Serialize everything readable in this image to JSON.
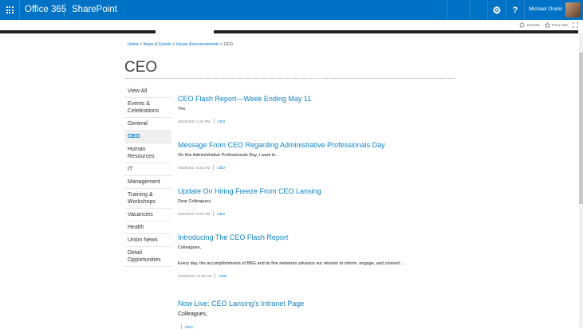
{
  "suite": {
    "brand": "Office 365",
    "app_name": "SharePoint",
    "settings_glyph": "⚙",
    "help_glyph": "?",
    "user_name": "Michael Osicki"
  },
  "actions": {
    "share": "SHARE",
    "follow": "FOLLOW"
  },
  "breadcrumb": {
    "items": [
      "Home",
      "News & Events",
      "House Announcements"
    ],
    "separator": ">",
    "current": "CEO"
  },
  "page": {
    "title": "CEO"
  },
  "nav": {
    "items": [
      "View All",
      "Events & Celebrations",
      "General",
      "CEO",
      "Human Resources",
      "IT",
      "Management",
      "Training & Workshops",
      "Vacancies",
      "Health",
      "Union News",
      "Detail Opportunities"
    ],
    "selected_index": 3
  },
  "posts": [
    {
      "title": "CEO Flash Report—Week Ending May 11",
      "excerpt": "The",
      "date": "05/18/2017 1:40 PM",
      "category": "CEO"
    },
    {
      "title": "Message From CEO Regarding Administrative Professionals Day",
      "excerpt": "On this Administrative Professionals Day, I want to...",
      "date": "04/26/2017 8:33 AM",
      "category": "CEO"
    },
    {
      "title": "Update On Hiring Freeze From CEO Lansing",
      "excerpt": "Dear Colleagues,",
      "date": "04/13/2017 9:03 AM",
      "category": "CEO"
    },
    {
      "title": "Introducing The CEO Flash Report",
      "excerpt": "Colleagues,",
      "excerpt2": "Every day, the accomplishments of BBG and its five networks advance our mission to inform, engage, and connect ...",
      "date": "04/05/2017 11:35 AM",
      "category": "CEO"
    },
    {
      "title": "Now Live: CEO Lansing's Intranet Page",
      "excerpt": "Colleagues,",
      "date": "",
      "category": "CEO"
    }
  ],
  "colors": {
    "suite_bar": "#0072c6",
    "link": "#0e84c8",
    "accent": "#0072c6"
  }
}
